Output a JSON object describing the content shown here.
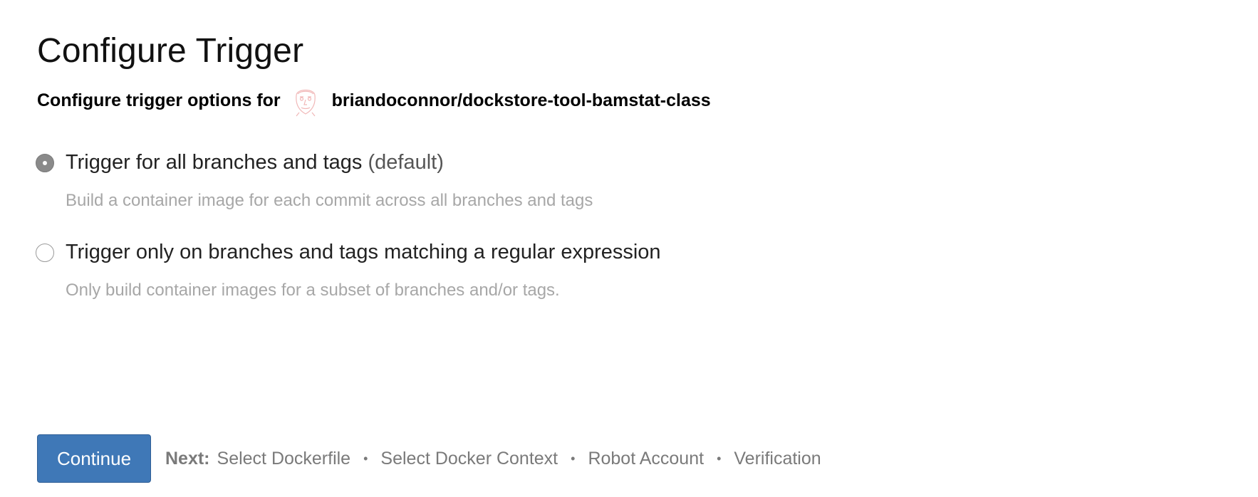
{
  "page": {
    "title": "Configure Trigger"
  },
  "subtitle": {
    "prefix": "Configure trigger options for",
    "avatar_icon": "avatar-sketch-icon",
    "repository": "briandoconnor/dockstore-tool-bamstat-class"
  },
  "options": [
    {
      "label": "Trigger for all branches and tags",
      "suffix": "(default)",
      "description": "Build a container image for each commit across all branches and tags",
      "selected": true
    },
    {
      "label": "Trigger only on branches and tags matching a regular expression",
      "suffix": "",
      "description": "Only build container images for a subset of branches and/or tags.",
      "selected": false
    }
  ],
  "footer": {
    "continue_label": "Continue",
    "next_label": "Next:",
    "steps": [
      "Select Dockerfile",
      "Select Docker Context",
      "Robot Account",
      "Verification"
    ],
    "separator": "•"
  },
  "colors": {
    "accent": "#3f78b7",
    "muted_text": "#a7a7a7",
    "radio_selected": "#8a8a8a"
  }
}
